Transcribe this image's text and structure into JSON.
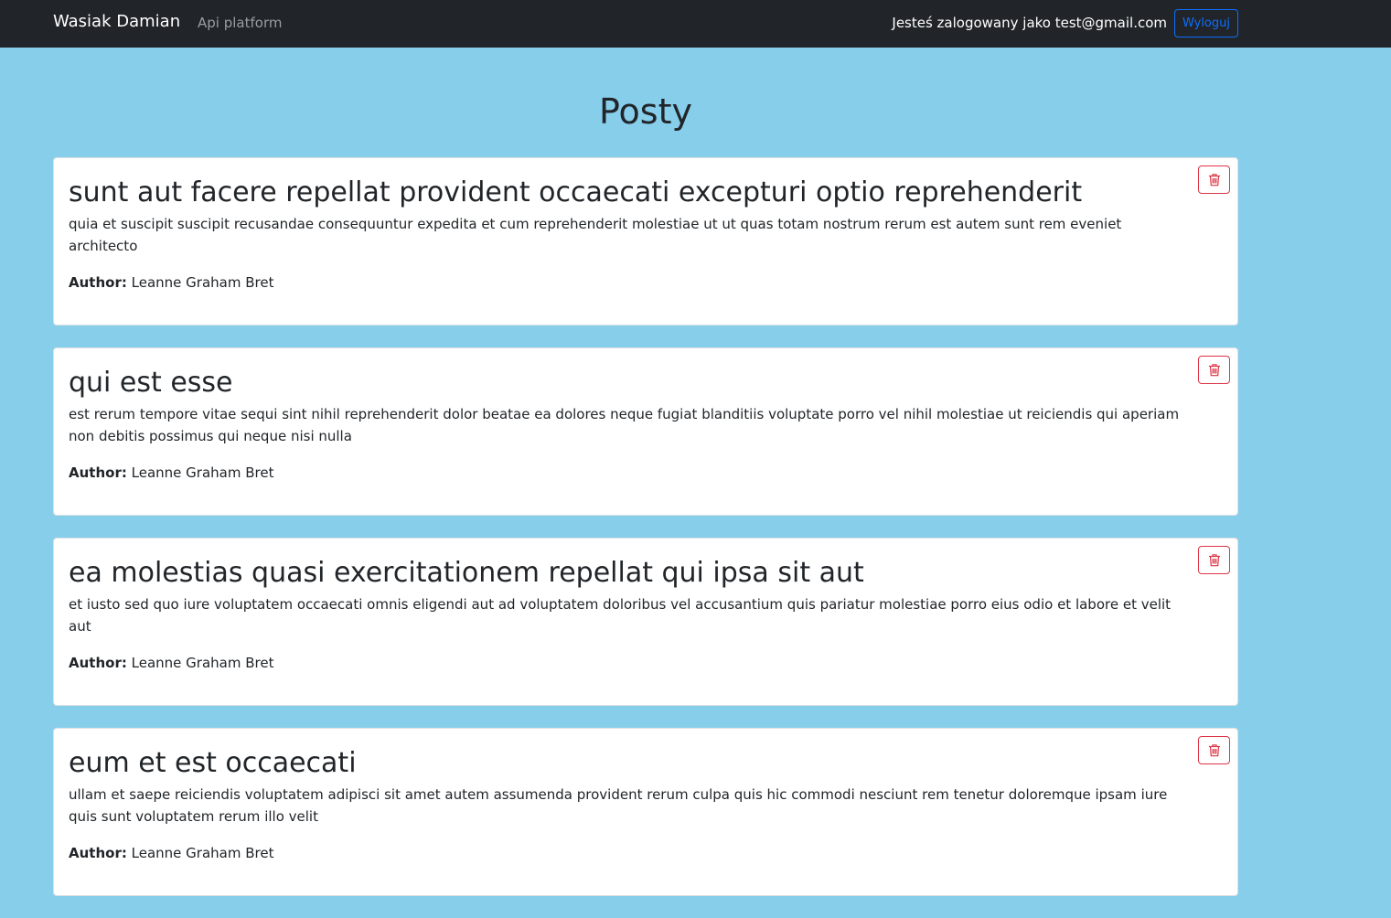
{
  "navbar": {
    "brand": "Wasiak Damian",
    "link": "Api platform",
    "logged_in_text": "Jesteś zalogowany jako test@gmail.com",
    "logout_label": "Wyloguj"
  },
  "main": {
    "title": "Posty",
    "posts": [
      {
        "title": "sunt aut facere repellat provident occaecati excepturi optio reprehenderit",
        "body": "quia et suscipit suscipit recusandae consequuntur expedita et cum reprehenderit molestiae ut ut quas totam nostrum rerum est autem sunt rem eveniet architecto",
        "author_label": "Author:",
        "author": "Leanne Graham Bret"
      },
      {
        "title": "qui est esse",
        "body": "est rerum tempore vitae sequi sint nihil reprehenderit dolor beatae ea dolores neque fugiat blanditiis voluptate porro vel nihil molestiae ut reiciendis qui aperiam non debitis possimus qui neque nisi nulla",
        "author_label": "Author:",
        "author": "Leanne Graham Bret"
      },
      {
        "title": "ea molestias quasi exercitationem repellat qui ipsa sit aut",
        "body": "et iusto sed quo iure voluptatem occaecati omnis eligendi aut ad voluptatem doloribus vel accusantium quis pariatur molestiae porro eius odio et labore et velit aut",
        "author_label": "Author:",
        "author": "Leanne Graham Bret"
      },
      {
        "title": "eum et est occaecati",
        "body": "ullam et saepe reiciendis voluptatem adipisci sit amet autem assumenda provident rerum culpa quis hic commodi nesciunt rem tenetur doloremque ipsam iure quis sunt voluptatem rerum illo velit",
        "author_label": "Author:",
        "author": "Leanne Graham Bret"
      }
    ],
    "delete_icon": "trash-icon"
  },
  "colors": {
    "background": "#87ceeb",
    "navbar": "#212529",
    "logout_accent": "#0d6efd",
    "delete_accent": "#dc3545"
  }
}
